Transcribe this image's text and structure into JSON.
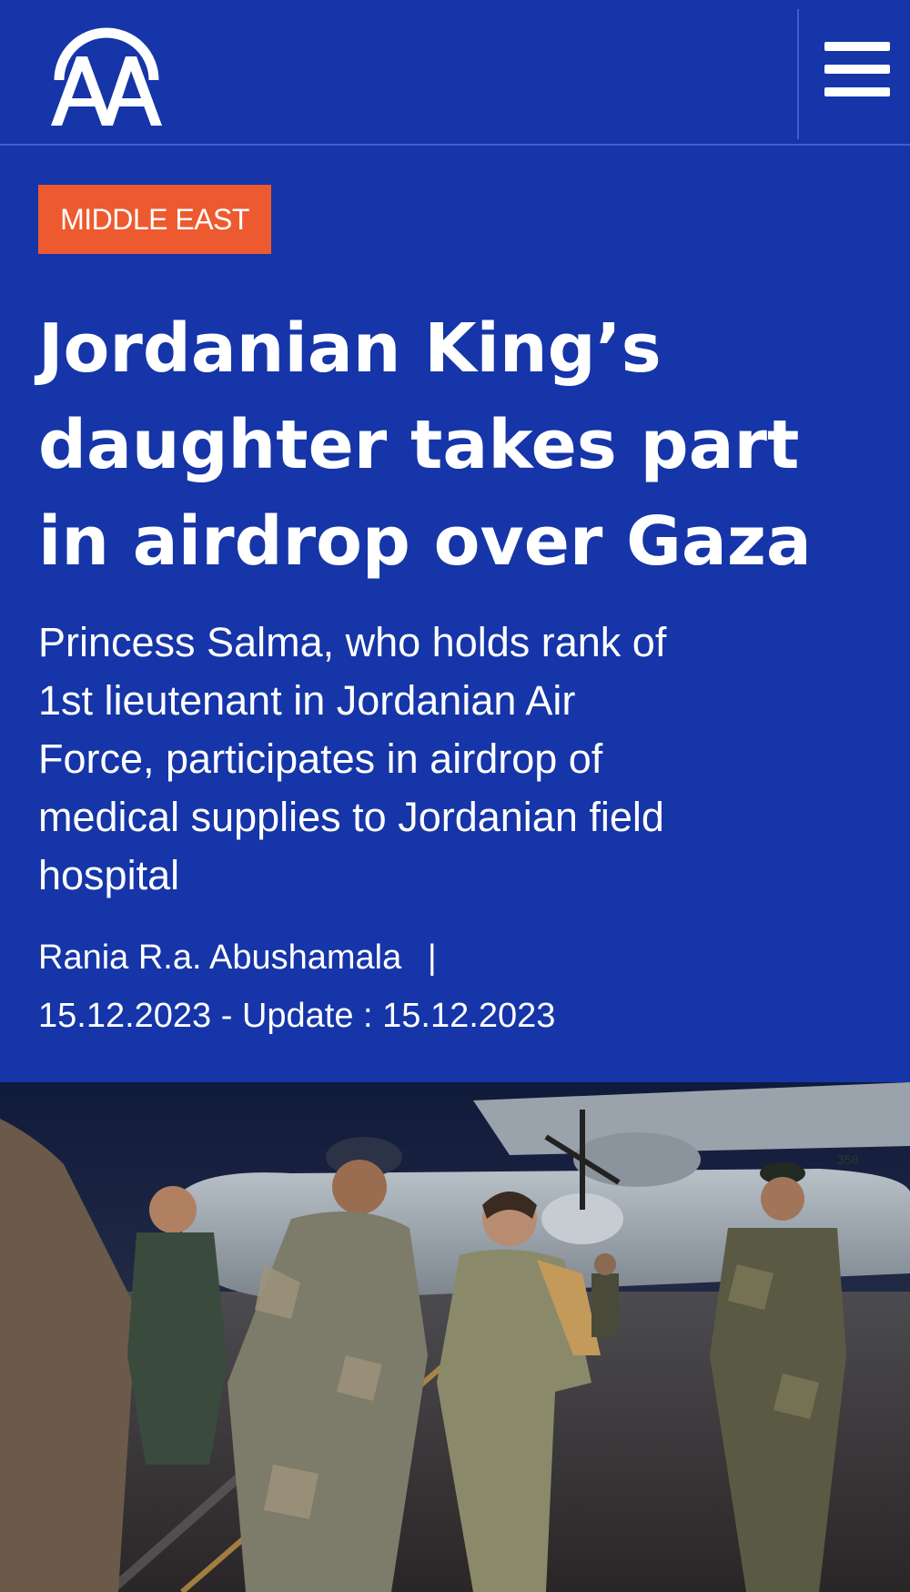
{
  "header": {
    "logo_text": "AA",
    "menu_icon": "hamburger-menu-icon"
  },
  "article": {
    "category": "MIDDLE EAST",
    "headline_lines": [
      "Jordanian King’s",
      "daughter takes part",
      "in airdrop over Gaza"
    ],
    "summary_lines": [
      "Princess Salma, who holds rank of",
      "1st lieutenant in Jordanian Air",
      "Force, participates in airdrop of",
      "medical supplies to Jordanian field",
      "hospital"
    ],
    "author": "Rania R.a. Abushamala",
    "author_separator": "|",
    "dates": "15.12.2023 - Update : 15.12.2023",
    "photo": {
      "aircraft_tail_number": "358"
    }
  },
  "colors": {
    "brand_blue": "#1535a8",
    "category_orange": "#ee5a2f",
    "divider": "#3f5fcf"
  }
}
